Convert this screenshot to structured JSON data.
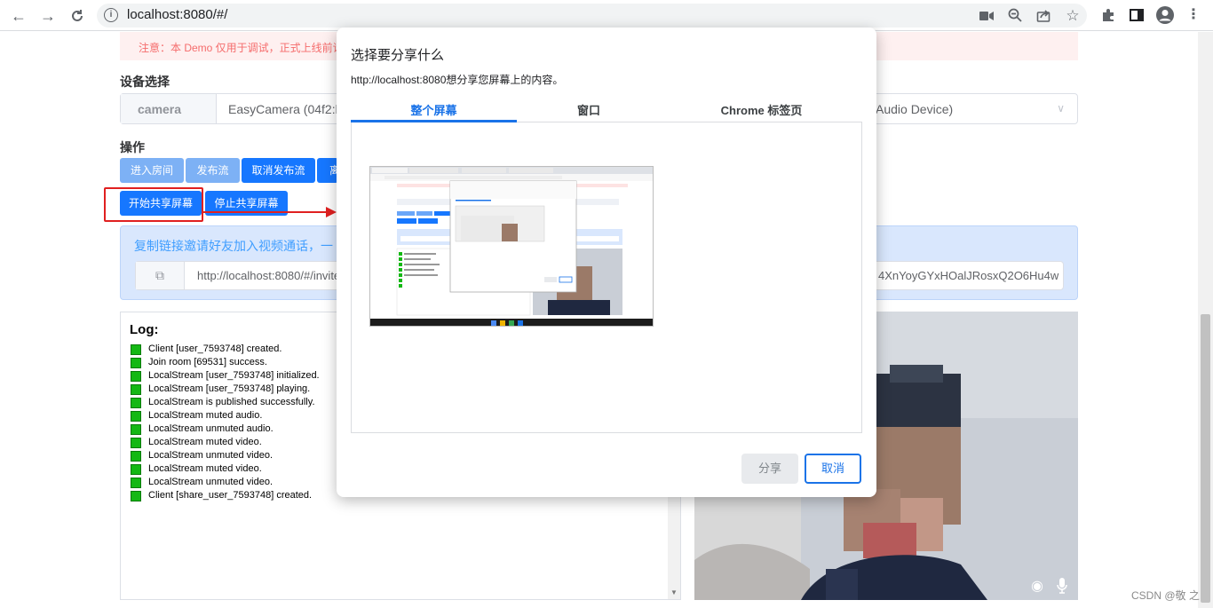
{
  "browser": {
    "url": "localhost:8080/#/",
    "icons": [
      "back-icon",
      "forward-icon",
      "reload-icon",
      "info-icon",
      "camera-icon",
      "zoom-icon",
      "share-icon",
      "bookmark-star-icon",
      "extensions-icon",
      "side-panel-icon",
      "profile-icon",
      "menu-icon"
    ]
  },
  "page": {
    "warning": "注意：本 Demo 仅用于调试，正式上线前请将",
    "device_title": "设备选择",
    "device_prefix": "camera",
    "camera_value": "EasyCamera (04f2:b5",
    "audio_value": "Audio Device)",
    "ops_title": "操作",
    "buttons": {
      "enter_room": "进入房间",
      "publish": "发布流",
      "unpublish": "取消发布流",
      "leave_partial": "离",
      "start_share": "开始共享屏幕",
      "stop_share": "停止共享屏幕"
    },
    "invite_text": "复制链接邀请好友加入视频通话，一",
    "invite_url": "http://localhost:8080/#/invite?",
    "invite_tail": "4XnYoyGYxHOalJRosxQ2O6Hu4w",
    "log_title": "Log:",
    "logs": [
      "Client [user_7593748] created.",
      "Join room [69531] success.",
      "LocalStream [user_7593748] initialized.",
      "LocalStream [user_7593748] playing.",
      "LocalStream is published successfully.",
      "LocalStream muted audio.",
      "LocalStream unmuted audio.",
      "LocalStream muted video.",
      "LocalStream unmuted video.",
      "LocalStream muted video.",
      "LocalStream unmuted video.",
      "Client [share_user_7593748] created."
    ],
    "watermark": "CSDN @敬 之"
  },
  "dialog": {
    "title": "选择要分享什么",
    "subtitle": "http://localhost:8080想分享您屏幕上的内容。",
    "tabs": [
      "整个屏幕",
      "窗口",
      "Chrome 标签页"
    ],
    "active_tab": 0,
    "share_label": "分享",
    "cancel_label": "取消"
  },
  "colors": {
    "primary": "#1677ff",
    "primary_light": "#7db1f5",
    "highlight": "#e02020",
    "log_ok": "#14b814",
    "chrome_blue": "#1a73e8"
  }
}
